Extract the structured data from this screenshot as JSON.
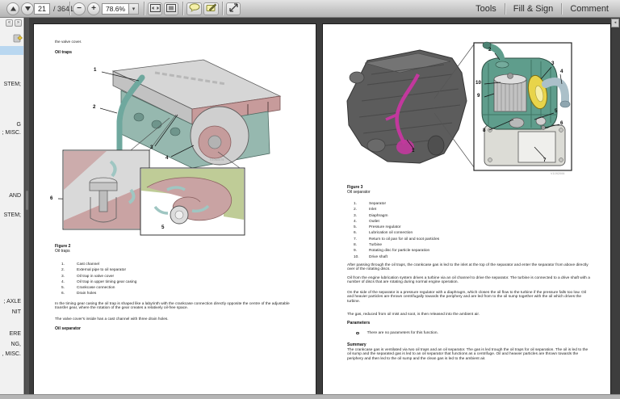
{
  "toolbar": {
    "page_current": "21",
    "page_total": "/ 3641",
    "zoom_value": "78.6%",
    "zoom_caret": "▾",
    "minus_glyph": "−",
    "plus_glyph": "+",
    "tools_label": "Tools",
    "fill_sign_label": "Fill & Sign",
    "comment_label": "Comment"
  },
  "sidebar": {
    "collapse_glyph": "«",
    "expand_glyph": "»",
    "fragments": [
      "STEM;",
      "G",
      "; MISC.",
      "AND",
      "STEM;",
      "; AXLE",
      "NIT",
      "ERE",
      "NG,",
      ", MISC."
    ]
  },
  "left_page": {
    "intro_line": "the valve cover.",
    "heading_oil_traps": "Oil traps",
    "fig_label": "Figure 2",
    "fig_sub": "Oil traps",
    "fig_id": "V1060075",
    "callouts": [
      "1",
      "2",
      "3",
      "4",
      "5",
      "6"
    ],
    "list": [
      {
        "n": "1.",
        "t": "Cast channel"
      },
      {
        "n": "2.",
        "t": "External pipe to oil separator"
      },
      {
        "n": "3.",
        "t": "Oil trap in valve cover"
      },
      {
        "n": "4.",
        "t": "Oil trap in upper timing gear casing"
      },
      {
        "n": "5.",
        "t": "Crankcase connection"
      },
      {
        "n": "6.",
        "t": "Drain holes"
      }
    ],
    "para1": "In the timing gear casing the oil trap is shaped like a labyrinth with the crankcase connection directly opposite the centre of the adjustable transfer gear, where the rotation of the gear creates a relatively oil-free space.",
    "para2": "The valve cover's inside has a cast channel with three drain holes.",
    "heading_oil_separator": "Oil separator"
  },
  "right_page": {
    "fig_label": "Figure 3",
    "fig_sub": "Oil separator",
    "fig_id": "V1092006",
    "callout_main": "1",
    "callouts": [
      "2",
      "3",
      "4",
      "5",
      "6",
      "7",
      "8",
      "9",
      "10"
    ],
    "list": [
      {
        "n": "1.",
        "t": "Separator"
      },
      {
        "n": "2.",
        "t": "Inlet"
      },
      {
        "n": "3.",
        "t": "Diaphragm"
      },
      {
        "n": "4.",
        "t": "Outlet"
      },
      {
        "n": "5.",
        "t": "Pressure regulator"
      },
      {
        "n": "6.",
        "t": "Lubrication oil connection"
      },
      {
        "n": "7.",
        "t": "Return to oil pan for oil and soot particles"
      },
      {
        "n": "8.",
        "t": "Turbine"
      },
      {
        "n": "9.",
        "t": "Rotating disc for particle separation"
      },
      {
        "n": "10.",
        "t": "Drive shaft"
      }
    ],
    "para1": "After passing through the oil traps, the crankcase gas is led to the inlet at the top of the separator and enter the separator from above directly over of the rotating discs.",
    "para2": "Oil from the engine lubrication system drives a turbine via an oil channel to drive the separator. The turbine is connected to a drive shaft with a number of discs that are rotating during normal engine operation.",
    "para3": "On the side of the separator is a pressure regulator with a diaphragm, which closes the oil flow to the turbine if the pressure falls too low. Oil and heavier particles are thrown centrifugally towards the periphery and are led from to the oil sump together with the oil which drives the turbine.",
    "para4": "The gas, reduced from oil mist and soot, is then released into the ambient air.",
    "parameters_heading": "Parameters",
    "parameters_bullet": "There are no parameters for this function.",
    "summary_heading": "Summary",
    "summary_text": "The crankcase gas is ventilated via two oil traps and an oil separator. The gas is led trough the oil traps for oil separation. The oil is led to the oil sump and the separated gas is led to an oil separator that functions as a centrifuge. Oil and heavier particles are thrown towards the periphery and then led to the oil sump and the clean gas is led to the ambient air."
  },
  "colors": {
    "background": "#3d3d3d",
    "toolbar": "#c6c6c6",
    "selection_blue": "#b9d7f0",
    "diagram_pink": "#c79b9b",
    "diagram_teal": "#6fa89e",
    "diagram_green": "#bfcc97",
    "highlight_magenta": "#c2389d",
    "highlight_yellow": "#e8d44a",
    "separator_body": "#5f9d8c"
  }
}
